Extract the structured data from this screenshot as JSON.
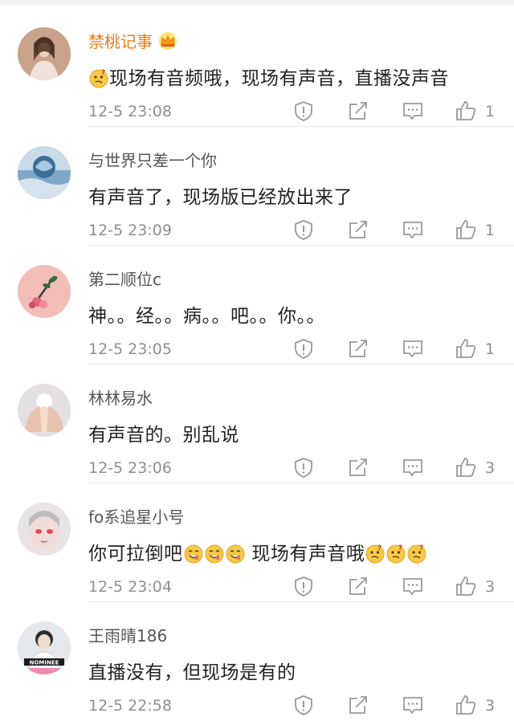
{
  "comments": [
    {
      "user": "禁桃记事",
      "vip": true,
      "text_parts": [
        "",
        "现场有音频哦，现场有声音，直播没声音"
      ],
      "time": "12-5 23:08",
      "likes": "1",
      "avatar_color": "#c99a7f"
    },
    {
      "user": "与世界只差一个你",
      "vip": false,
      "text": "有声音了，现场版已经放出来了",
      "time": "12-5 23:09",
      "likes": "1",
      "avatar_color": "#6d93b6"
    },
    {
      "user": "第二顺位c",
      "vip": false,
      "text": "神。。经。。病。。吧。。你。。",
      "time": "12-5 23:05",
      "likes": "1",
      "avatar_color": "#f0b6b1"
    },
    {
      "user": "林林易水",
      "vip": false,
      "text": "有声音的。别乱说",
      "time": "12-5 23:06",
      "likes": "3",
      "avatar_color": "#d9cfcf"
    },
    {
      "user": "fo系追星小号",
      "vip": false,
      "text_parts": [
        "你可拉倒吧",
        "现场有声音哦"
      ],
      "time": "12-5 23:04",
      "likes": "3",
      "avatar_color": "#e7dfe2"
    },
    {
      "user": "王雨晴186",
      "vip": false,
      "text": "直播没有，但现场是有的",
      "time": "12-5 22:58",
      "likes": "3",
      "avatar_color": "#dfe3e8",
      "avatar_badge": "NOMINEE"
    }
  ],
  "icons": [
    "report-icon",
    "share-icon",
    "comment-icon",
    "like-icon",
    "crown-icon",
    "confused-emoji-icon",
    "yum-emoji-icon"
  ],
  "colors": {
    "vip_name": "#e87d1c",
    "name": "#555555",
    "text": "#222222",
    "meta": "#8f8f8f"
  }
}
